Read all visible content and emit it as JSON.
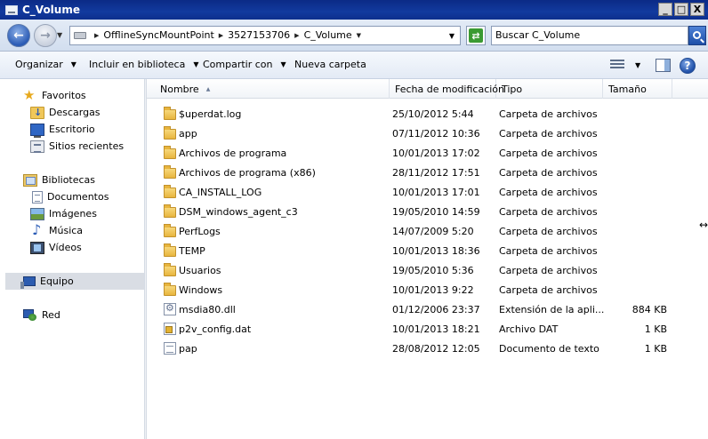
{
  "window": {
    "title": "C_Volume",
    "controls": {
      "minimize": "_",
      "maximize": "□",
      "close": "X"
    }
  },
  "address": {
    "breadcrumbs": [
      "OfflineSyncMountPoint",
      "3527153706",
      "C_Volume"
    ],
    "search_value": "Buscar C_Volume"
  },
  "toolbar": {
    "organize": "Organizar",
    "include_library": "Incluir en biblioteca",
    "share_with": "Compartir con",
    "new_folder": "Nueva carpeta",
    "help": "?"
  },
  "nav": {
    "favorites": "Favoritos",
    "downloads": "Descargas",
    "desktop": "Escritorio",
    "recent": "Sitios recientes",
    "libraries": "Bibliotecas",
    "documents": "Documentos",
    "images": "Imágenes",
    "music": "Música",
    "videos": "Vídeos",
    "computer": "Equipo",
    "network": "Red"
  },
  "columns": {
    "name": "Nombre",
    "modified": "Fecha de modificación",
    "type": "Tipo",
    "size": "Tamaño"
  },
  "files": [
    {
      "name": "$uperdat.log",
      "modified": "25/10/2012 5:44",
      "type": "Carpeta de archivos",
      "size": "",
      "icon": "folder-icon"
    },
    {
      "name": "app",
      "modified": "07/11/2012 10:36",
      "type": "Carpeta de archivos",
      "size": "",
      "icon": "folder-icon"
    },
    {
      "name": "Archivos de programa",
      "modified": "10/01/2013 17:02",
      "type": "Carpeta de archivos",
      "size": "",
      "icon": "folder-icon"
    },
    {
      "name": "Archivos de programa (x86)",
      "modified": "28/11/2012 17:51",
      "type": "Carpeta de archivos",
      "size": "",
      "icon": "folder-icon"
    },
    {
      "name": "CA_INSTALL_LOG",
      "modified": "10/01/2013 17:01",
      "type": "Carpeta de archivos",
      "size": "",
      "icon": "folder-icon"
    },
    {
      "name": "DSM_windows_agent_c3",
      "modified": "19/05/2010 14:59",
      "type": "Carpeta de archivos",
      "size": "",
      "icon": "folder-icon"
    },
    {
      "name": "PerfLogs",
      "modified": "14/07/2009 5:20",
      "type": "Carpeta de archivos",
      "size": "",
      "icon": "folder-icon"
    },
    {
      "name": "TEMP",
      "modified": "10/01/2013 18:36",
      "type": "Carpeta de archivos",
      "size": "",
      "icon": "folder-icon"
    },
    {
      "name": "Usuarios",
      "modified": "19/05/2010 5:36",
      "type": "Carpeta de archivos",
      "size": "",
      "icon": "folder-icon"
    },
    {
      "name": "Windows",
      "modified": "10/01/2013 9:22",
      "type": "Carpeta de archivos",
      "size": "",
      "icon": "folder-icon"
    },
    {
      "name": "msdia80.dll",
      "modified": "01/12/2006 23:37",
      "type": "Extensión de la apli...",
      "size": "884 KB",
      "icon": "dll-file-icon"
    },
    {
      "name": "p2v_config.dat",
      "modified": "10/01/2013 18:21",
      "type": "Archivo DAT",
      "size": "1 KB",
      "icon": "dat-file-icon"
    },
    {
      "name": "pap",
      "modified": "28/08/2012 12:05",
      "type": "Documento de texto",
      "size": "1 KB",
      "icon": "text-file-icon"
    }
  ]
}
